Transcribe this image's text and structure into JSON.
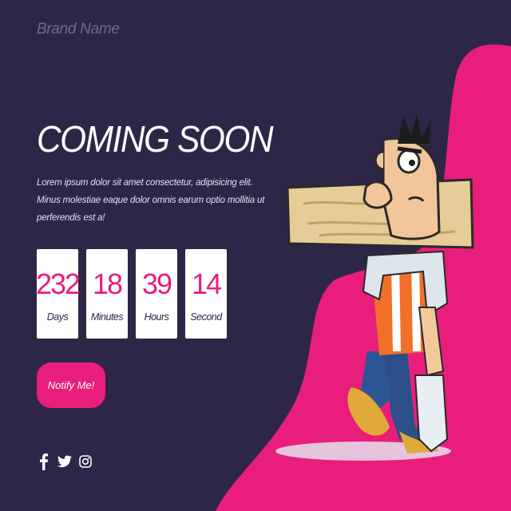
{
  "brand": {
    "name": "Brand Name"
  },
  "hero": {
    "title": "COMING SOON",
    "description": "Lorem ipsum dolor sit amet consectetur, adipisicing elit. Minus molestiae eaque dolor omnis earum optio mollitia ut perferendis est a!"
  },
  "countdown": [
    {
      "value": "232",
      "label": "Days"
    },
    {
      "value": "18",
      "label": "Minutes"
    },
    {
      "value": "39",
      "label": "Hours"
    },
    {
      "value": "14",
      "label": "Second"
    }
  ],
  "cta": {
    "notify_label": "Notify Me!"
  },
  "social": [
    {
      "icon": "facebook-icon"
    },
    {
      "icon": "twitter-icon"
    },
    {
      "icon": "instagram-icon"
    }
  ],
  "colors": {
    "background": "#2e2647",
    "accent": "#e91e7a",
    "tile": "#ffffff"
  }
}
